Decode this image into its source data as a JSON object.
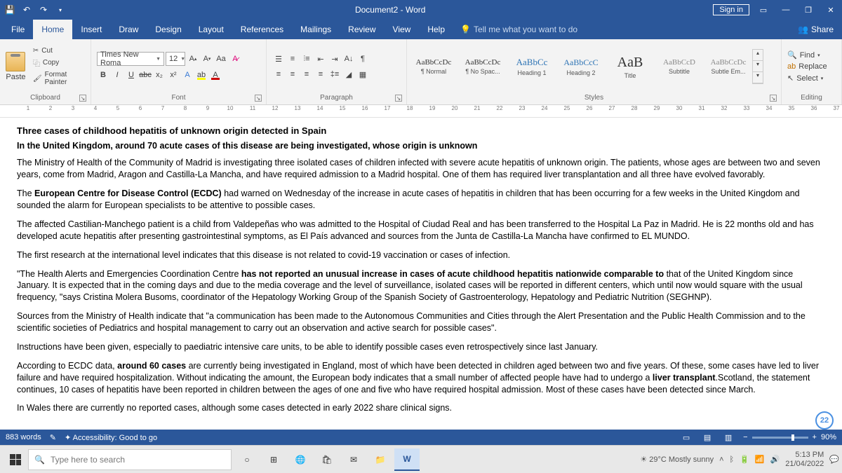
{
  "title_bar": {
    "doc_title": "Document2 - Word",
    "signin": "Sign in"
  },
  "menu": {
    "tabs": [
      "File",
      "Home",
      "Insert",
      "Draw",
      "Design",
      "Layout",
      "References",
      "Mailings",
      "Review",
      "View",
      "Help"
    ],
    "tell_me": "Tell me what you want to do",
    "share": "Share"
  },
  "ribbon": {
    "clipboard": {
      "label": "Clipboard",
      "paste": "Paste",
      "cut": "Cut",
      "copy": "Copy",
      "fp": "Format Painter"
    },
    "font": {
      "label": "Font",
      "name": "Times New Roma",
      "size": "12"
    },
    "paragraph": {
      "label": "Paragraph"
    },
    "styles": {
      "label": "Styles",
      "items": [
        {
          "preview": "AaBbCcDc",
          "name": "¶ Normal",
          "size": "11px",
          "color": "#333"
        },
        {
          "preview": "AaBbCcDc",
          "name": "¶ No Spac...",
          "size": "11px",
          "color": "#333"
        },
        {
          "preview": "AaBbCc",
          "name": "Heading 1",
          "size": "13px",
          "color": "#2e74b5"
        },
        {
          "preview": "AaBbCcC",
          "name": "Heading 2",
          "size": "12px",
          "color": "#2e74b5"
        },
        {
          "preview": "AaB",
          "name": "Title",
          "size": "20px",
          "color": "#333"
        },
        {
          "preview": "AaBbCcD",
          "name": "Subtitle",
          "size": "11px",
          "color": "#888"
        },
        {
          "preview": "AaBbCcDc",
          "name": "Subtle Em...",
          "size": "11px",
          "color": "#888"
        }
      ]
    },
    "editing": {
      "label": "Editing",
      "find": "Find",
      "replace": "Replace",
      "select": "Select"
    }
  },
  "document": {
    "title": "Three cases of childhood hepatitis of unknown origin detected in Spain",
    "subtitle": "In the United Kingdom, around 70 acute cases of this disease are being investigated, whose origin is unknown",
    "p1": "The Ministry of Health of the Community of Madrid is investigating three isolated cases of children infected with severe acute hepatitis of unknown origin. The patients, whose ages are between two and seven years, come from Madrid, Aragon and Castilla-La Mancha, and have required admission to a Madrid hospital. One of them has required liver transplantation and all three have evolved favorably.",
    "p2a": "The ",
    "p2b": "European Centre for Disease Control (ECDC)",
    "p2c": " had warned on Wednesday of the increase in acute cases of hepatitis in children that has been occurring for a few weeks in the United Kingdom and sounded the alarm for European specialists to be attentive to possible cases.",
    "p3": "The affected Castilian-Manchego patient is a child from Valdepeñas who was admitted to the Hospital of Ciudad Real and has been transferred to the Hospital La Paz in Madrid. He is 22 months old and has developed acute hepatitis after presenting gastrointestinal symptoms, as El País advanced and sources from the Junta de Castilla-La Mancha have confirmed to EL MUNDO.",
    "p4": "The first research at the international level indicates that this disease is not related to covid-19 vaccination or cases of infection.",
    "p5a": "\"The Health Alerts and Emergencies Coordination Centre ",
    "p5b": "has not reported an unusual increase in cases of acute childhood hepatitis nationwide comparable to",
    "p5c": " that of the United Kingdom since January. It is expected that in the coming days and due to the media coverage and the level of surveillance, isolated cases will be reported in different centers, which until now would square with the usual frequency, \"says Cristina Molera Busoms, coordinator of the Hepatology Working Group of the Spanish Society of Gastroenterology, Hepatology and Pediatric Nutrition (SEGHNP).",
    "p6": "Sources from the Ministry of Health indicate that \"a communication has been made to the Autonomous Communities and Cities through the Alert Presentation and the Public Health Commission and to the scientific societies of Pediatrics and hospital management to carry out an observation and active search for possible cases\".",
    "p7": "Instructions have been given, especially to paediatric intensive care units, to be able to identify possible cases even retrospectively since last January.",
    "p8a": "According to ECDC data, ",
    "p8b": "around 60 cases",
    "p8c": " are currently being investigated in England, most of which have been detected in children aged between two and five years. Of these, some cases have led to liver failure and have required hospitalization. Without indicating the amount, the European body indicates that a small number of affected people have had to undergo a ",
    "p8d": "liver transplant",
    "p8e": ".Scotland, the statement continues, 10 cases of hepatitis have been reported in children between the ages of one and five who have required hospital admission. Most of these cases have been detected since March.",
    "p9": "In Wales there are currently no reported cases, although some cases detected in early 2022 share clinical signs."
  },
  "status": {
    "words": "883 words",
    "access": "Accessibility: Good to go",
    "zoom": "90%"
  },
  "taskbar": {
    "search": "Type here to search",
    "weather": "29°C Mostly sunny",
    "time": "5:13 PM",
    "date": "21/04/2022"
  },
  "badge": "22"
}
